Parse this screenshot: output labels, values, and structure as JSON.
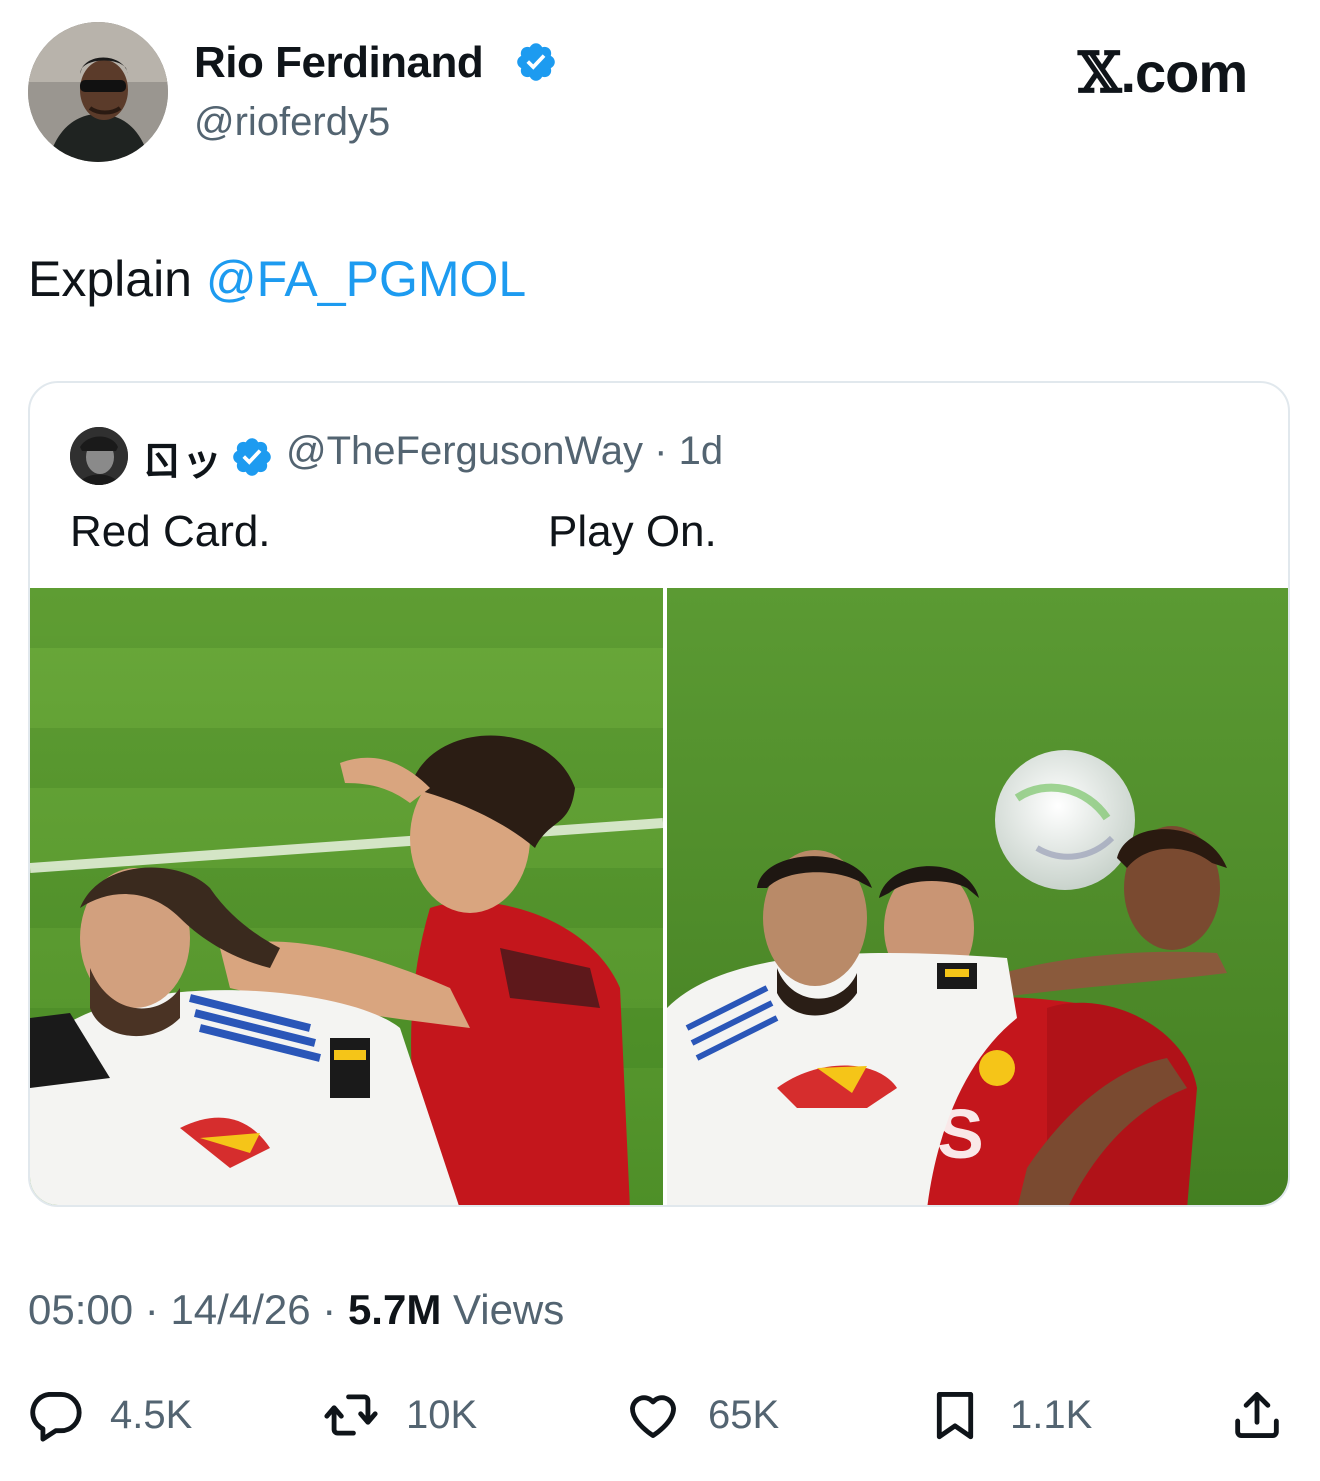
{
  "author": {
    "name": "Rio Ferdinand",
    "handle": "@rioferdy5",
    "verified_icon": "verified-badge-icon",
    "verified_color": "#1d9bf0"
  },
  "brand": {
    "x_mark": "𝕏",
    "suffix": ".com"
  },
  "tweet": {
    "text_prefix": "Explain ",
    "mention": "@FA_PGMOL"
  },
  "quote": {
    "name": "ㄖッ",
    "handle": "@TheFergusonWay",
    "separator": "·",
    "age": "1d",
    "left_caption": "Red Card.",
    "right_caption": "Play On."
  },
  "meta": {
    "time": "05:00",
    "date": "14/4/26",
    "separator": "·",
    "views_count": "5.7M",
    "views_label": "Views"
  },
  "actions": {
    "replies": "4.5K",
    "reposts": "10K",
    "likes": "65K",
    "bookmarks": "1.1K"
  },
  "colors": {
    "accent": "#1d9bf0",
    "text": "#0f1419",
    "muted": "#536471",
    "pitch_green": "#5a9a2e"
  }
}
